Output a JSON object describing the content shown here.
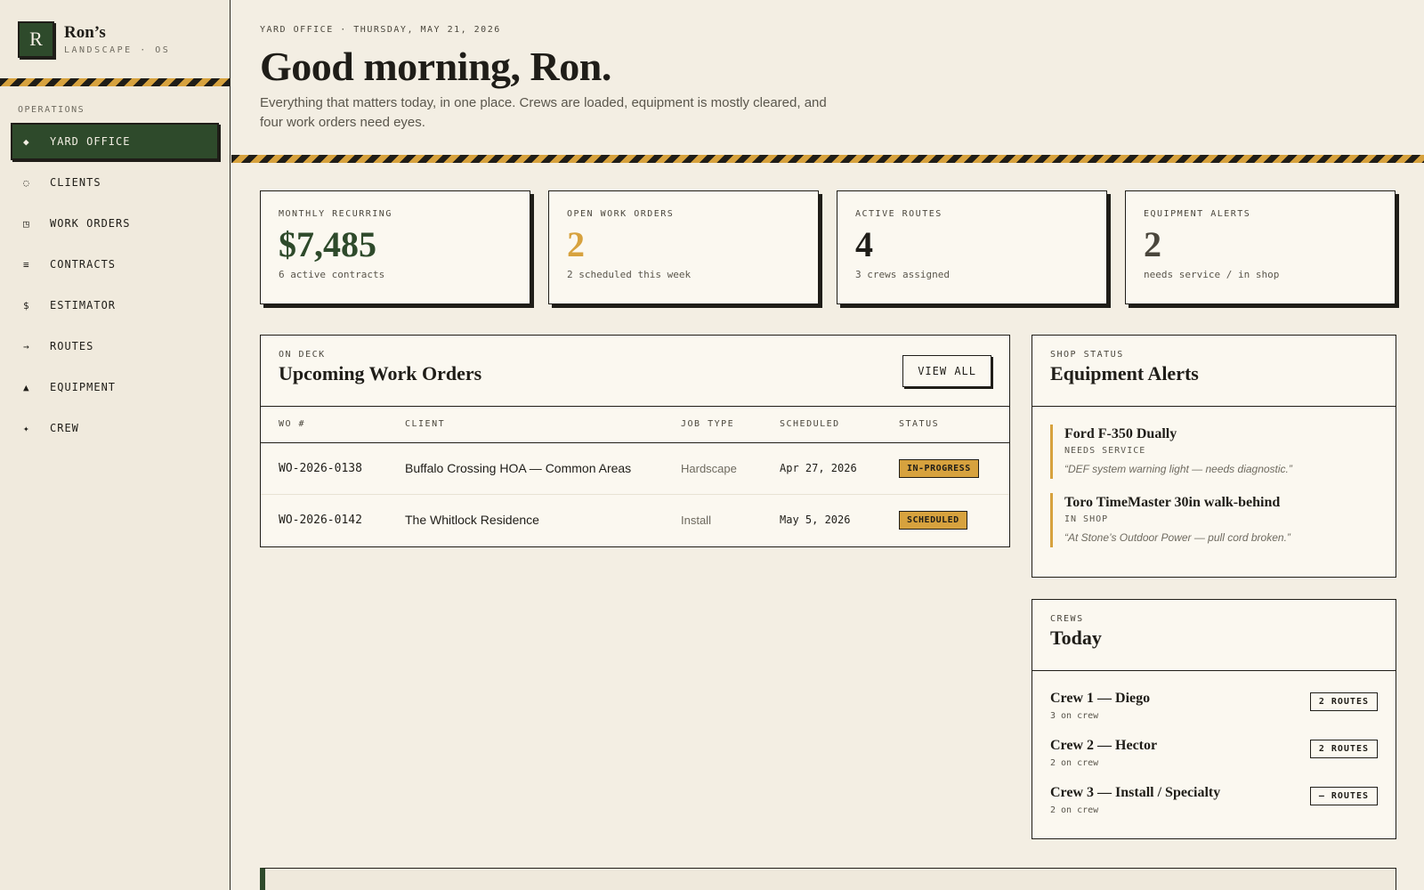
{
  "brand": {
    "mark": "R",
    "name": "Ron’s",
    "sub": "LANDSCAPE · OS"
  },
  "nav": {
    "section": "OPERATIONS",
    "items": [
      {
        "icon": "◆",
        "label": "YARD OFFICE"
      },
      {
        "icon": "◌",
        "label": "CLIENTS"
      },
      {
        "icon": "◳",
        "label": "WORK ORDERS"
      },
      {
        "icon": "≡",
        "label": "CONTRACTS"
      },
      {
        "icon": "$",
        "label": "ESTIMATOR"
      },
      {
        "icon": "→",
        "label": "ROUTES"
      },
      {
        "icon": "▲",
        "label": "EQUIPMENT"
      },
      {
        "icon": "✦",
        "label": "CREW"
      }
    ]
  },
  "header": {
    "eyebrow": "YARD OFFICE · THURSDAY, MAY 21, 2026",
    "title": "Good morning, Ron.",
    "lead": "Everything that matters today, in one place. Crews are loaded, equipment is mostly cleared, and four work orders need eyes."
  },
  "kpis": [
    {
      "label": "MONTHLY RECURRING",
      "value": "$7,485",
      "sub": "6 active contracts",
      "color": "#2e4a2b"
    },
    {
      "label": "OPEN WORK ORDERS",
      "value": "2",
      "sub": "2 scheduled this week",
      "color": "#d7a23e"
    },
    {
      "label": "ACTIVE ROUTES",
      "value": "4",
      "sub": "3 crews assigned",
      "color": "#1f1d18"
    },
    {
      "label": "EQUIPMENT ALERTS",
      "value": "2",
      "sub": "needs service / in shop",
      "color": "#4a463c"
    }
  ],
  "work_orders": {
    "eyebrow": "ON DECK",
    "title": "Upcoming Work Orders",
    "view_all": "VIEW ALL",
    "columns": [
      "WO #",
      "CLIENT",
      "JOB TYPE",
      "SCHEDULED",
      "STATUS"
    ],
    "rows": [
      {
        "wo": "WO-2026-0138",
        "client": "Buffalo Crossing HOA — Common Areas",
        "type": "Hardscape",
        "date": "Apr 27, 2026",
        "status": "IN-PROGRESS"
      },
      {
        "wo": "WO-2026-0142",
        "client": "The Whitlock Residence",
        "type": "Install",
        "date": "May 5, 2026",
        "status": "SCHEDULED"
      }
    ]
  },
  "equipment": {
    "eyebrow": "SHOP STATUS",
    "title": "Equipment Alerts",
    "items": [
      {
        "name": "Ford F-350 Dually",
        "status": "NEEDS SERVICE",
        "note": "“DEF system warning light — needs diagnostic.”"
      },
      {
        "name": "Toro TimeMaster 30in walk-behind",
        "status": "IN SHOP",
        "note": "“At Stone’s Outdoor Power — pull cord broken.”"
      }
    ]
  },
  "crews": {
    "eyebrow": "CREWS",
    "title": "Today",
    "items": [
      {
        "name": "Crew 1 — Diego",
        "sub": "3 on crew",
        "routes": "2 ROUTES"
      },
      {
        "name": "Crew 2 — Hector",
        "sub": "2 on crew",
        "routes": "2 ROUTES"
      },
      {
        "name": "Crew 3 — Install / Specialty",
        "sub": "2 on crew",
        "routes": "— ROUTES"
      }
    ]
  },
  "colors": {
    "accent_green": "#2e4a2b",
    "accent_gold": "#d7a23e",
    "ink": "#1f1d18",
    "paper": "#f3eee3"
  }
}
